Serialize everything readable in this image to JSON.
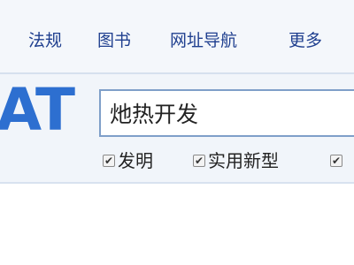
{
  "nav": {
    "items": [
      {
        "label": "法规"
      },
      {
        "label": "图书"
      },
      {
        "label": "网址导航"
      },
      {
        "label": "更多"
      }
    ]
  },
  "logo": {
    "text": "AT"
  },
  "search": {
    "value": "灺热开发"
  },
  "filters": [
    {
      "label": "发明",
      "checked": true
    },
    {
      "label": "实用新型",
      "checked": true
    },
    {
      "label": "",
      "checked": true
    }
  ],
  "colors": {
    "nav_text": "#1f3f8f",
    "logo": "#2d6fd0",
    "input_border": "#7f9fc9",
    "background": "#f1f5fa"
  }
}
